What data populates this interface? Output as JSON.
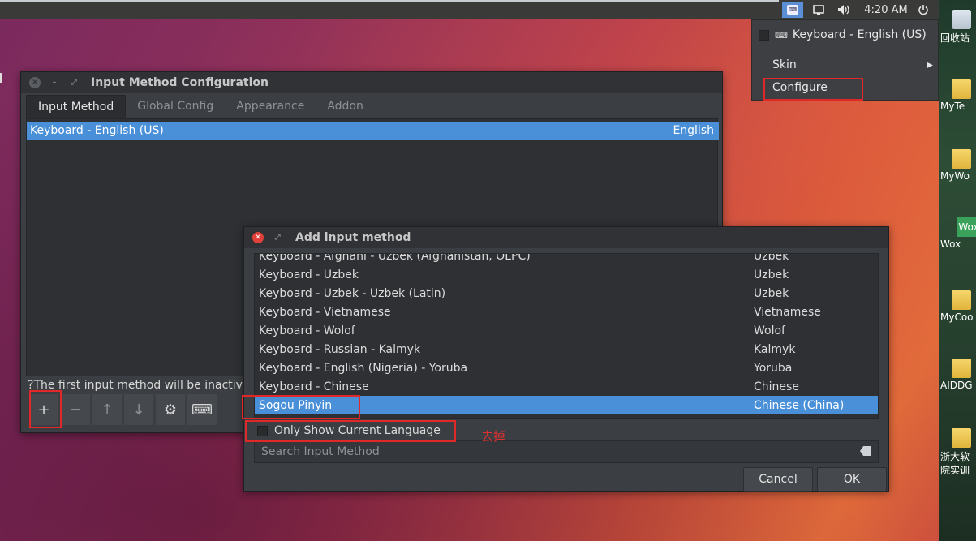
{
  "topbar": {
    "fcitx_icon": "keyboard-tray-icon",
    "clock": "4:20 AM"
  },
  "desktop_icons": [
    {
      "label": "回收站",
      "icon": "recycle-bin-icon"
    },
    {
      "label": "MyTe",
      "icon": "folder-icon"
    },
    {
      "label": "MyWo",
      "icon": "folder-icon"
    },
    {
      "label": "Wox",
      "icon": "wox-icon",
      "badge": "Wox"
    },
    {
      "label": "MyCoo",
      "icon": "folder-icon"
    },
    {
      "label": "AIDDG",
      "icon": "file-icon"
    },
    {
      "label": "浙大软件学院实训",
      "line1": "浙大软",
      "line2": "院实训",
      "icon": "folder-icon"
    }
  ],
  "tray_menu": {
    "current": "Keyboard - English (US)",
    "skin": "Skin",
    "configure": "Configure"
  },
  "config_dialog": {
    "title": "Input Method Configuration",
    "tabs": [
      "Input Method",
      "Global Config",
      "Appearance",
      "Addon"
    ],
    "active_tab": "Input Method",
    "rows": [
      {
        "name": "Keyboard - English (US)",
        "lang": "English"
      }
    ],
    "hint": "The first input method will be inactive",
    "hint_icon": "?",
    "tools": {
      "add": "+",
      "remove": "−",
      "up": "↑",
      "down": "↓",
      "settings": "⚙",
      "keyboard": "⌨"
    }
  },
  "add_dialog": {
    "title": "Add input method",
    "rows": [
      {
        "name": "Keyboard - Afghani - Uzbek (Afghanistan, OLPC)",
        "lang": "Uzbek"
      },
      {
        "name": "Keyboard - Uzbek",
        "lang": "Uzbek"
      },
      {
        "name": "Keyboard - Uzbek - Uzbek (Latin)",
        "lang": "Uzbek"
      },
      {
        "name": "Keyboard - Vietnamese",
        "lang": "Vietnamese"
      },
      {
        "name": "Keyboard - Wolof",
        "lang": "Wolof"
      },
      {
        "name": "Keyboard - Russian - Kalmyk",
        "lang": "Kalmyk"
      },
      {
        "name": "Keyboard - English (Nigeria) - Yoruba",
        "lang": "Yoruba"
      },
      {
        "name": "Keyboard - Chinese",
        "lang": "Chinese"
      },
      {
        "name": "Sogou Pinyin",
        "lang": "Chinese (China)"
      }
    ],
    "selected_index": 8,
    "only_current_language": "Only Show Current Language",
    "only_current_checked": false,
    "search_placeholder": "Search Input Method",
    "cancel": "Cancel",
    "ok": "OK"
  },
  "annotation": "去掉",
  "colors": {
    "selection": "#4a90d9",
    "highlight_box": "#e02828",
    "annotation": "#e03030"
  }
}
